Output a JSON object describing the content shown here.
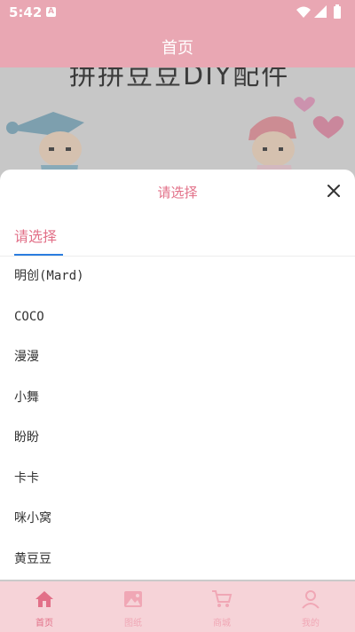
{
  "status_bar": {
    "time": "5:42",
    "notification_letter": "A"
  },
  "header": {
    "title": "首页"
  },
  "banner": {
    "text": "拼拼豆豆DIY配件"
  },
  "sheet": {
    "title": "请选择",
    "tab_label": "请选择",
    "options": [
      "明创(Mard)",
      "COCO",
      "漫漫",
      "小舞",
      "盼盼",
      "卡卡",
      "咪小窝",
      "黄豆豆"
    ]
  },
  "bottom_nav": [
    {
      "label": "首页",
      "icon": "home-icon",
      "active": true
    },
    {
      "label": "图纸",
      "icon": "image-icon",
      "active": false
    },
    {
      "label": "商城",
      "icon": "cart-icon",
      "active": false
    },
    {
      "label": "我的",
      "icon": "user-icon",
      "active": false
    }
  ],
  "colors": {
    "primary": "#e9a7b3",
    "accent": "#e27088",
    "tab_indicator": "#2b7de0",
    "nav_bg": "#f6d3d8"
  }
}
